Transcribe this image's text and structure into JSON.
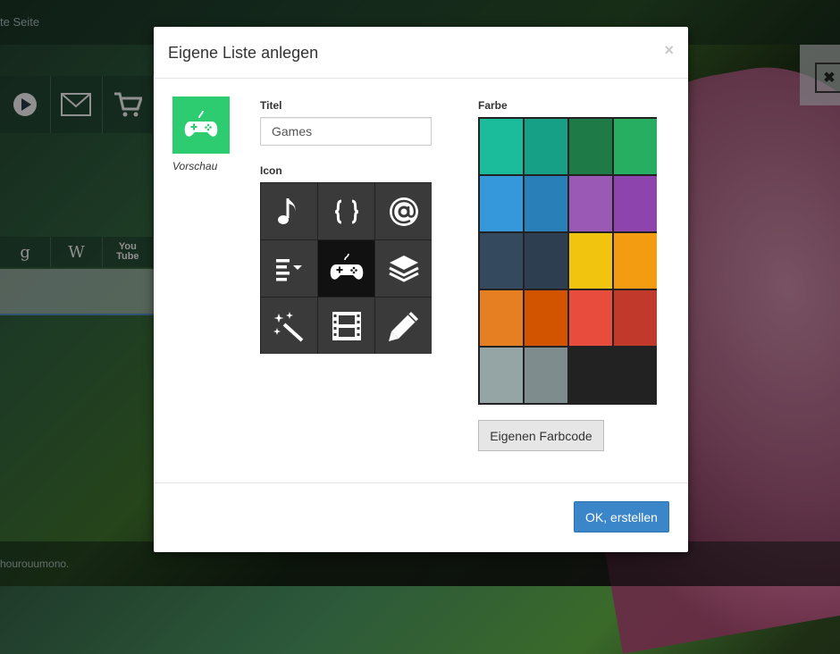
{
  "background": {
    "topbar_text": "te Seite",
    "footer_text": "hourouumono.",
    "toolbar_icons": [
      "play-icon",
      "mail-icon",
      "cart-icon"
    ],
    "search_icons": [
      {
        "name": "google-icon",
        "glyph": "g"
      },
      {
        "name": "wikipedia-icon",
        "glyph": "W"
      },
      {
        "name": "youtube-icon",
        "glyph": "You\nTube"
      }
    ],
    "right_panel_close": "✖"
  },
  "modal": {
    "title": "Eigene Liste anlegen",
    "close_label": "×",
    "preview": {
      "label": "Vorschau",
      "color": "#2ecc71",
      "icon": "gamepad-icon"
    },
    "title_field": {
      "label": "Titel",
      "value": "Games"
    },
    "icon_section": {
      "label": "Icon",
      "selected": "gamepad-icon",
      "icons": [
        "music-note-icon",
        "curly-braces-icon",
        "at-sign-icon",
        "list-dropdown-icon",
        "gamepad-icon",
        "layers-icon",
        "magic-wand-icon",
        "film-icon",
        "pencil-icon"
      ]
    },
    "color_section": {
      "label": "Farbe",
      "selected": "#1e8449",
      "colors": [
        "#1abc9c",
        "#16a085",
        "#1e7a46",
        "#27ae60",
        "#3498db",
        "#2980b9",
        "#9b59b6",
        "#8e44ad",
        "#34495e",
        "#2c3e50",
        "#f1c40f",
        "#f39c12",
        "#e67e22",
        "#d35400",
        "#e74c3c",
        "#c0392b",
        "#95a5a6",
        "#7f8c8d"
      ]
    },
    "custom_color_button": "Eigenen Farbcode",
    "ok_button": "OK, erstellen"
  }
}
